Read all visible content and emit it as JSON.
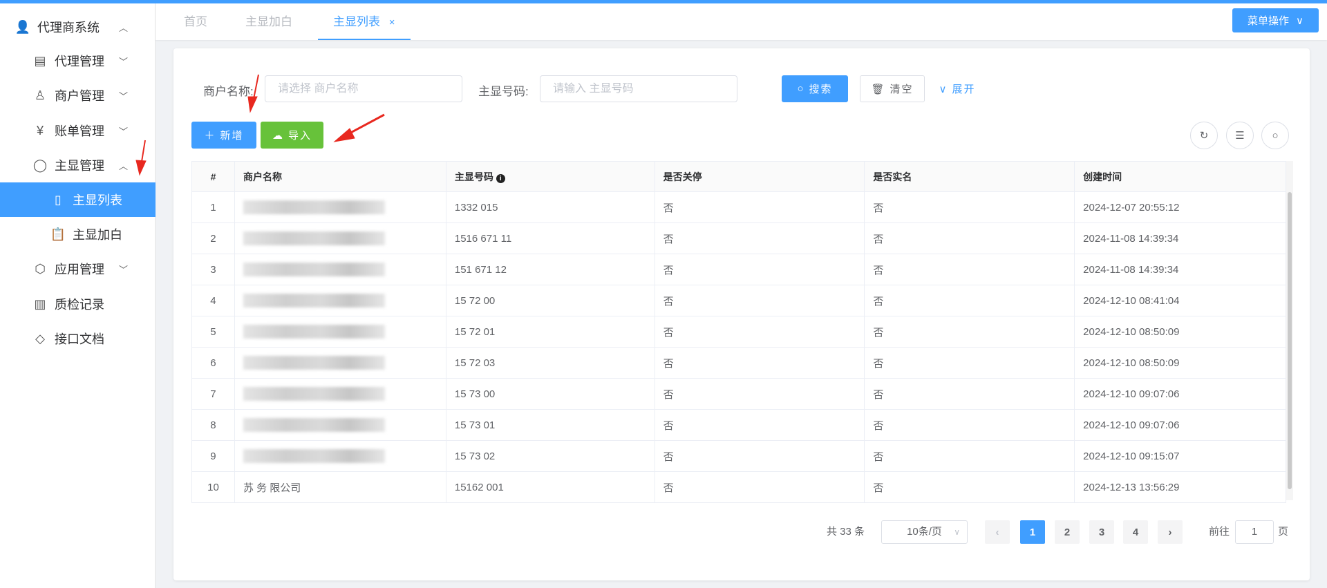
{
  "sidebar": {
    "items": [
      {
        "label": "代理商系统",
        "icon": "org-icon",
        "chev": "^"
      },
      {
        "label": "代理管理",
        "icon": "doc-icon",
        "chev": "v"
      },
      {
        "label": "商户管理",
        "icon": "user-icon",
        "chev": "v"
      },
      {
        "label": "账单管理",
        "icon": "bill-icon",
        "chev": "v"
      },
      {
        "label": "主显管理",
        "icon": "phone-icon",
        "chev": "^"
      },
      {
        "label": "主显列表",
        "icon": "mobile-icon"
      },
      {
        "label": "主显加白",
        "icon": "clipboard-icon"
      },
      {
        "label": "应用管理",
        "icon": "cube-icon",
        "chev": "v"
      },
      {
        "label": "质检记录",
        "icon": "record-icon"
      },
      {
        "label": "接口文档",
        "icon": "tag-icon"
      }
    ]
  },
  "tabs": [
    {
      "label": "首页"
    },
    {
      "label": "主显加白"
    },
    {
      "label": "主显列表",
      "close": "×"
    }
  ],
  "menu_button": "菜单操作",
  "filters": {
    "merchant_label": "商户名称:",
    "merchant_placeholder": "请选择 商户名称",
    "phone_label": "主显号码:",
    "phone_placeholder": "请输入 主显号码",
    "search": "搜索",
    "clear": "清空",
    "expand": "展开"
  },
  "actions": {
    "add": "新增",
    "import": "导入"
  },
  "table": {
    "headers": [
      "#",
      "商户名称",
      "主显号码",
      "是否关停",
      "是否实名",
      "创建时间"
    ],
    "rows": [
      {
        "n": "1",
        "name": "",
        "phone": "1332 015",
        "stop": "否",
        "real": "否",
        "time": "2024-12-07 20:55:12"
      },
      {
        "n": "2",
        "name": "",
        "phone": "1516 671 11",
        "stop": "否",
        "real": "否",
        "time": "2024-11-08 14:39:34"
      },
      {
        "n": "3",
        "name": "",
        "phone": "151 671 12",
        "stop": "否",
        "real": "否",
        "time": "2024-11-08 14:39:34"
      },
      {
        "n": "4",
        "name": "",
        "phone": "15 72 00",
        "stop": "否",
        "real": "否",
        "time": "2024-12-10 08:41:04"
      },
      {
        "n": "5",
        "name": "",
        "phone": "15 72 01",
        "stop": "否",
        "real": "否",
        "time": "2024-12-10 08:50:09"
      },
      {
        "n": "6",
        "name": "",
        "phone": "15 72 03",
        "stop": "否",
        "real": "否",
        "time": "2024-12-10 08:50:09"
      },
      {
        "n": "7",
        "name": "",
        "phone": "15 73 00",
        "stop": "否",
        "real": "否",
        "time": "2024-12-10 09:07:06"
      },
      {
        "n": "8",
        "name": "",
        "phone": "15 73 01",
        "stop": "否",
        "real": "否",
        "time": "2024-12-10 09:07:06"
      },
      {
        "n": "9",
        "name": "",
        "phone": "15 73 02",
        "stop": "否",
        "real": "否",
        "time": "2024-12-10 09:15:07"
      },
      {
        "n": "10",
        "name": "苏 务 限公司",
        "phone": "15162 001",
        "stop": "否",
        "real": "否",
        "time": "2024-12-13 13:56:29"
      }
    ]
  },
  "pagination": {
    "total": "共 33 条",
    "page_size": "10条/页",
    "pages": [
      "1",
      "2",
      "3",
      "4"
    ],
    "current": "1",
    "goto_label": "前往",
    "goto_value": "1",
    "goto_suffix": "页"
  },
  "colors": {
    "primary": "#409eff",
    "success": "#67c23a",
    "annotation": "#e8281f"
  }
}
